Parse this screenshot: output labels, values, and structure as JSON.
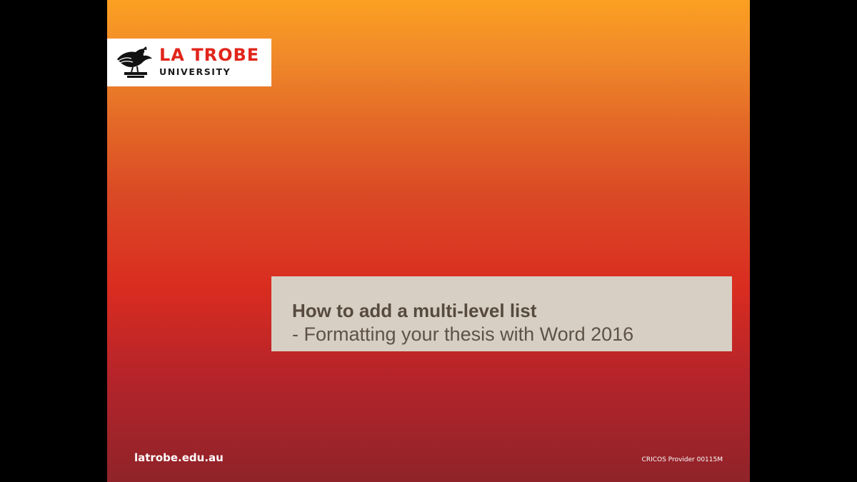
{
  "slide": {
    "logo": {
      "line1": "LA TROBE",
      "line2": "UNIVERSITY",
      "emblem_icon": "eagle-emblem-icon"
    },
    "title": {
      "main": "How to add a multi-level list",
      "subtitle": "- Formatting your thesis with Word 2016"
    },
    "footer": {
      "url": "latrobe.edu.au",
      "cricos": "CRICOS Provider 00115M"
    }
  },
  "colors": {
    "brand_red": "#e1251b",
    "title_box": "#d7cfc3",
    "title_text": "#574a3e",
    "gradient_top": "#fba022",
    "gradient_mid": "#d92c20",
    "gradient_bottom": "#8f2329",
    "letterbox": "#000000"
  }
}
